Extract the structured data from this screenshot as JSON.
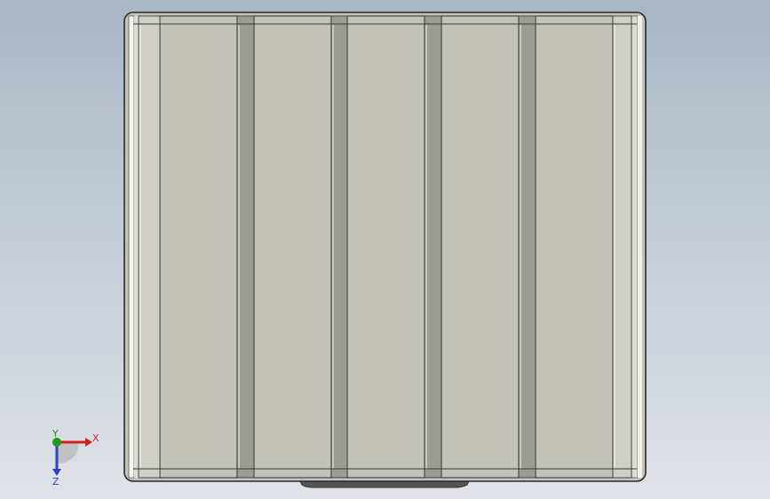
{
  "viewport": {
    "model": {
      "type": "extrusion-profile",
      "view": "top",
      "fin_count": 5,
      "colors": {
        "face": "#c2c2b9",
        "face_light": "#cfcfc6",
        "groove": "#9c9c93",
        "edge_highlight": "#f4f4f1",
        "edge_dark": "#2c2c2c",
        "shadow_base": "#555555"
      }
    },
    "triad": {
      "x_label": "X",
      "y_label": "Y",
      "z_label": "Z",
      "colors": {
        "x": "#d21f1f",
        "y": "#1b9a1b",
        "z": "#2f3fbf"
      }
    }
  }
}
